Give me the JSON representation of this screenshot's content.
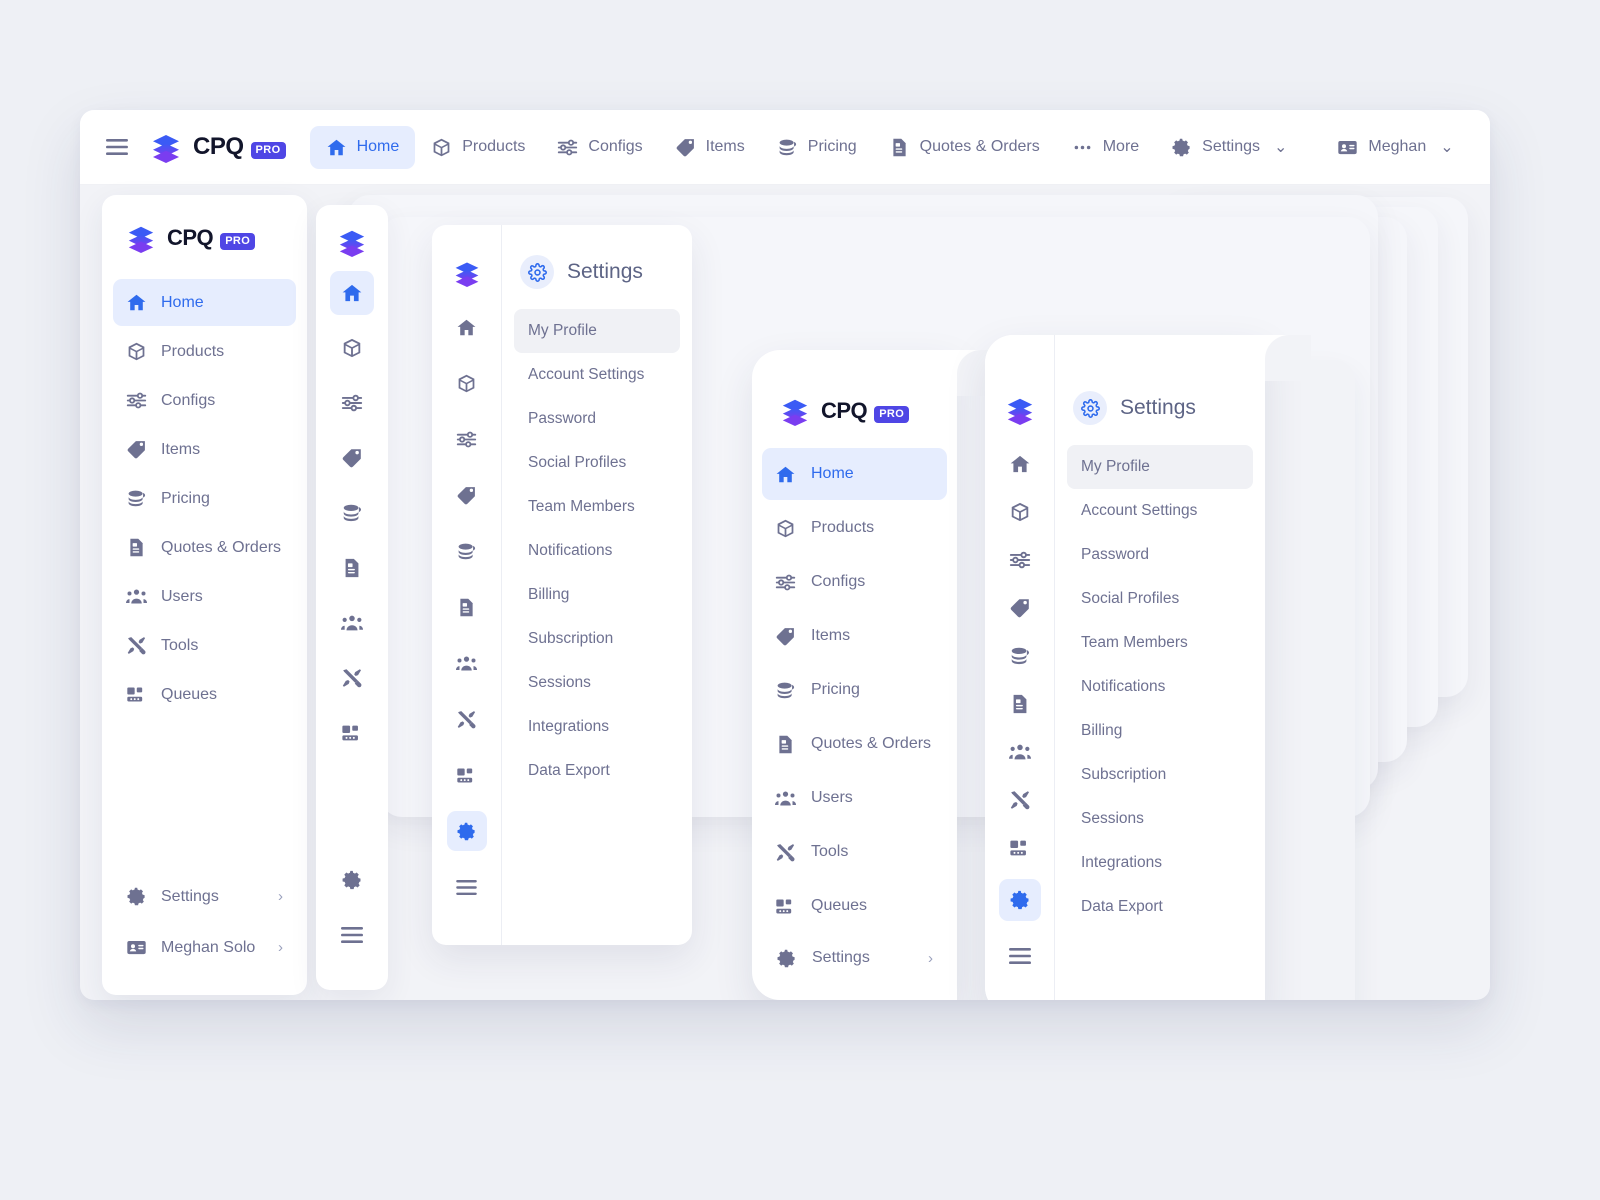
{
  "brand": {
    "name": "CPQ",
    "badge": "PRO",
    "accent": "#2f6bed",
    "logo_gradient_top": "#3b5bf5",
    "logo_gradient_bottom": "#7a3df0",
    "badge_bg": "#4f46e5",
    "muted_text": "#6e7191",
    "active_bg": "#e6edfe",
    "page_bg": "#eef0f5"
  },
  "topbar": {
    "menu_icon": "hamburger-icon",
    "nav": [
      {
        "label": "Home",
        "icon": "home-icon",
        "active": true
      },
      {
        "label": "Products",
        "icon": "box-icon",
        "active": false
      },
      {
        "label": "Configs",
        "icon": "sliders-icon",
        "active": false
      },
      {
        "label": "Items",
        "icon": "tag-icon",
        "active": false
      },
      {
        "label": "Pricing",
        "icon": "coins-icon",
        "active": false
      },
      {
        "label": "Quotes & Orders",
        "icon": "document-icon",
        "active": false
      },
      {
        "label": "More",
        "icon": "ellipsis-icon",
        "active": false
      }
    ],
    "right": [
      {
        "label": "Settings",
        "icon": "gear-icon",
        "caret": "⌄"
      },
      {
        "label": "Meghan",
        "icon": "id-card-icon",
        "caret": "⌄"
      }
    ]
  },
  "sidebar": {
    "items": [
      {
        "label": "Home",
        "icon": "home-icon",
        "active": true
      },
      {
        "label": "Products",
        "icon": "box-icon",
        "active": false
      },
      {
        "label": "Configs",
        "icon": "sliders-icon",
        "active": false
      },
      {
        "label": "Items",
        "icon": "tag-icon",
        "active": false
      },
      {
        "label": "Pricing",
        "icon": "coins-icon",
        "active": false
      },
      {
        "label": "Quotes & Orders",
        "icon": "document-icon",
        "active": false
      },
      {
        "label": "Users",
        "icon": "users-icon",
        "active": false
      },
      {
        "label": "Tools",
        "icon": "tools-icon",
        "active": false
      },
      {
        "label": "Queues",
        "icon": "queues-icon",
        "active": false
      }
    ],
    "bottom": [
      {
        "label": "Settings",
        "icon": "gear-icon",
        "chevron": "›"
      },
      {
        "label": "Meghan Solo",
        "icon": "id-card-icon",
        "chevron": "›"
      }
    ]
  },
  "rail": {
    "items": [
      {
        "icon": "home-icon",
        "active": true
      },
      {
        "icon": "box-icon",
        "active": false
      },
      {
        "icon": "sliders-icon",
        "active": false
      },
      {
        "icon": "tag-icon",
        "active": false
      },
      {
        "icon": "coins-icon",
        "active": false
      },
      {
        "icon": "document-icon",
        "active": false
      },
      {
        "icon": "users-icon",
        "active": false
      },
      {
        "icon": "tools-icon",
        "active": false
      },
      {
        "icon": "queues-icon",
        "active": false
      }
    ],
    "bottom": [
      {
        "icon": "gear-icon",
        "active": false
      },
      {
        "icon": "hamburger-icon",
        "active": false
      }
    ]
  },
  "rail_settings": {
    "items": [
      {
        "icon": "home-icon",
        "active": false
      },
      {
        "icon": "box-icon",
        "active": false
      },
      {
        "icon": "sliders-icon",
        "active": false
      },
      {
        "icon": "tag-icon",
        "active": false
      },
      {
        "icon": "coins-icon",
        "active": false
      },
      {
        "icon": "document-icon",
        "active": false
      },
      {
        "icon": "users-icon",
        "active": false
      },
      {
        "icon": "tools-icon",
        "active": false
      },
      {
        "icon": "queues-icon",
        "active": false
      }
    ],
    "bottom": [
      {
        "icon": "gear-icon",
        "active": true
      },
      {
        "icon": "hamburger-icon",
        "active": false
      }
    ]
  },
  "settings_panel": {
    "title": "Settings",
    "title_icon": "gear-outline-icon",
    "items": [
      {
        "label": "My Profile",
        "active": true
      },
      {
        "label": "Account Settings",
        "active": false
      },
      {
        "label": "Password",
        "active": false
      },
      {
        "label": "Social Profiles",
        "active": false
      },
      {
        "label": "Team Members",
        "active": false
      },
      {
        "label": "Notifications",
        "active": false
      },
      {
        "label": "Billing",
        "active": false
      },
      {
        "label": "Subscription",
        "active": false
      },
      {
        "label": "Sessions",
        "active": false
      },
      {
        "label": "Integrations",
        "active": false
      },
      {
        "label": "Data Export",
        "active": false
      }
    ]
  }
}
